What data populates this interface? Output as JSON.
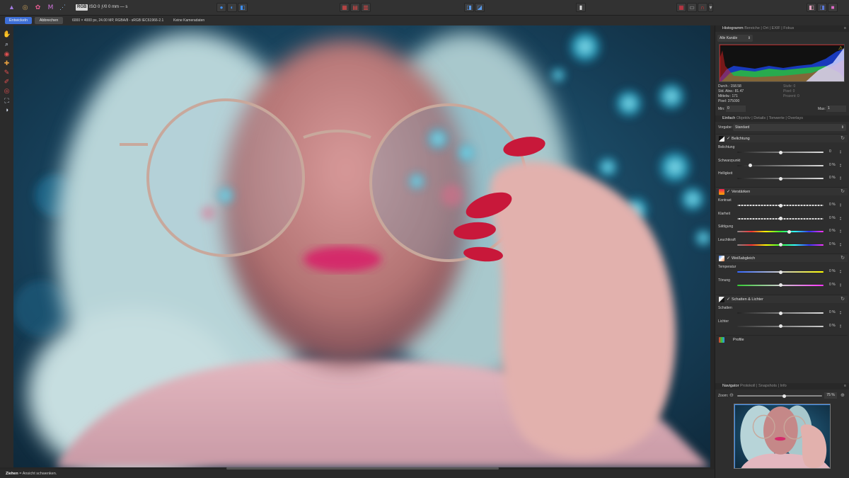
{
  "toolbar": {
    "rgb_badge": "RGB",
    "exif_summary": "ISO 0 ƒ/0 0 mm — s",
    "persona_icons": [
      "photo-persona-icon",
      "liquify-persona-icon",
      "develop-persona-icon",
      "tone-mapping-persona-icon",
      "export-persona-icon"
    ]
  },
  "context": {
    "develop_label": "Entwickeln",
    "cancel_label": "Abbrechen",
    "image_info": "6000 × 4000 px, 24.00 MP, RGBA/8 - sRGB IEC61966-2.1",
    "camera_info": "Keine Kameradaten"
  },
  "histogram": {
    "tabs": [
      "Histogramm",
      "Bereiche",
      "Ort",
      "EXIF",
      "Fokus"
    ],
    "channel": "Alle Kanäle",
    "stats_left": [
      "Durch.: 158.58",
      "Std. Abw.: 81.47",
      "Mittelw.: 171",
      "Pixel: 375000"
    ],
    "stats_right": [
      "Stufe: 0",
      "Pixel: 0",
      "Prozent: 0"
    ],
    "min_label": "Min:",
    "min_value": "0",
    "max_label": "Max:",
    "max_value": "1"
  },
  "adjust": {
    "tabs": [
      "Einfach",
      "Objektiv",
      "Details",
      "Tonwerte",
      "Overlays"
    ],
    "preset_label": "Vorgabe:",
    "preset_value": "Standard",
    "exposure": {
      "title": "Belichtung",
      "sliders": [
        {
          "label": "Belichtung",
          "value": "0",
          "pos": 0.5
        },
        {
          "label": "Schwarzpunkt",
          "value": "0 %",
          "pos": 0.15
        },
        {
          "label": "Helligkeit",
          "value": "0 %",
          "pos": 0.5
        }
      ]
    },
    "enhance": {
      "title": "Verstärken",
      "sliders": [
        {
          "label": "Kontrast",
          "value": "0 %",
          "pos": 0.5
        },
        {
          "label": "Klarheit",
          "value": "0 %",
          "pos": 0.5
        },
        {
          "label": "Sättigung",
          "value": "0 %",
          "pos": 0.6
        },
        {
          "label": "Leuchtkraft",
          "value": "0 %",
          "pos": 0.5
        }
      ]
    },
    "white_balance": {
      "title": "Weißabgleich",
      "sliders": [
        {
          "label": "Temperatur",
          "value": "0 %",
          "pos": 0.5
        },
        {
          "label": "Tönung",
          "value": "0 %",
          "pos": 0.5
        }
      ]
    },
    "shadows": {
      "title": "Schatten & Lichter",
      "sliders": [
        {
          "label": "Schatten",
          "value": "0 %",
          "pos": 0.5
        },
        {
          "label": "Lichter",
          "value": "0 %",
          "pos": 0.5
        }
      ]
    },
    "profiles_label": "Profile"
  },
  "navigator": {
    "tabs": [
      "Navigator",
      "Protokoll",
      "Snapshots",
      "Info"
    ],
    "zoom_label": "Zoom:",
    "zoom_value": "75 %",
    "zoom_level": 0.55
  },
  "status": {
    "bold": "Ziehen",
    "text": " = Ansicht schwenken."
  },
  "colors": {
    "accent": "#3e6fd6",
    "panel": "#2e2e2e",
    "nail_red": "#c8183a"
  }
}
